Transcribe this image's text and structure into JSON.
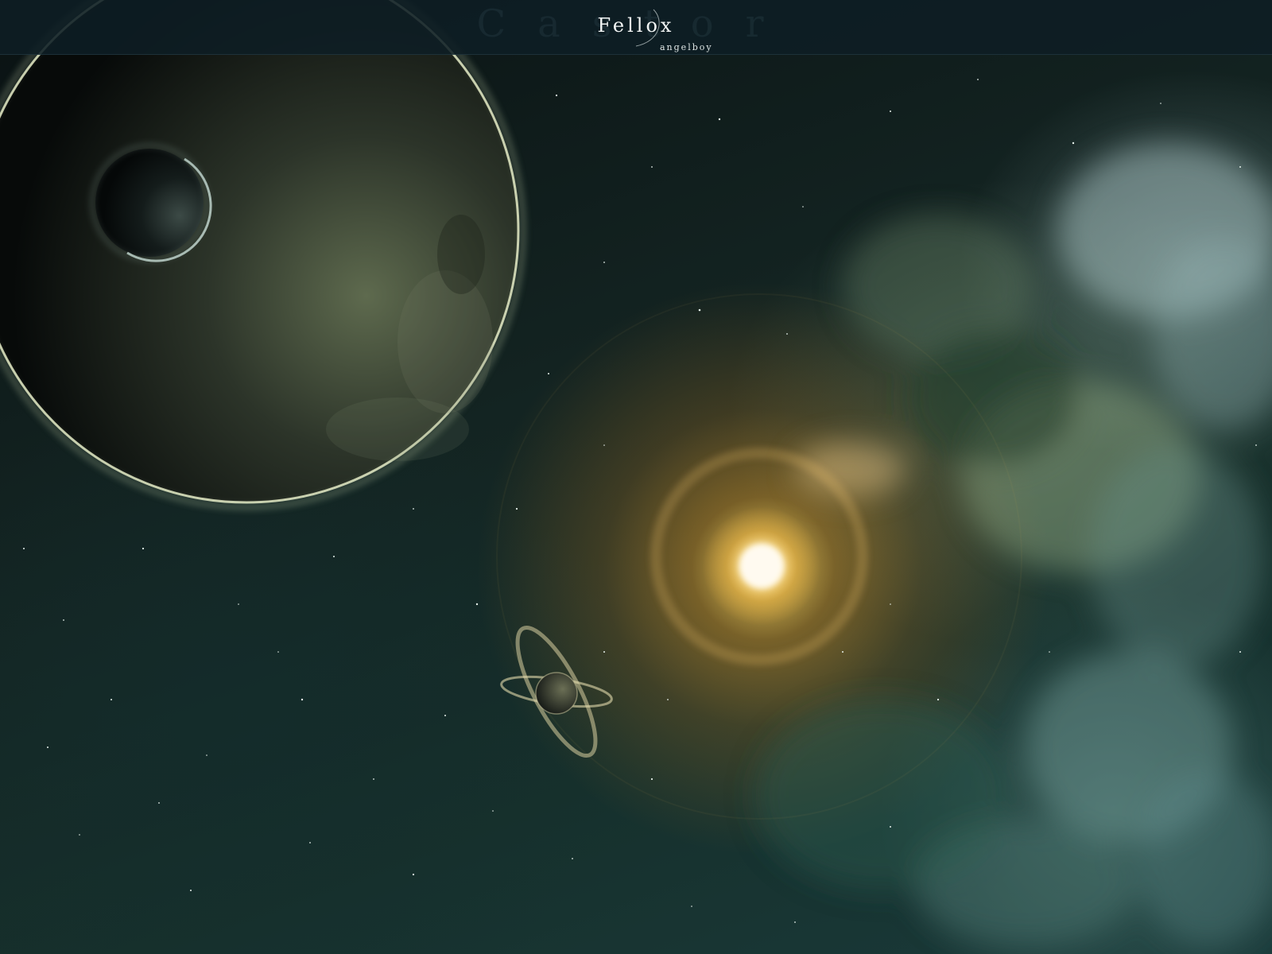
{
  "header": {
    "ghost_title": "Castor",
    "title": "Fellox",
    "subtitle": "angelboy"
  },
  "colors": {
    "space_dark": "#0b1517",
    "space_teal": "#1a3a3a",
    "sun_core": "#fff6d8",
    "sun_glow": "#f0a028",
    "planet_rim": "#e8ecc8",
    "nebula": "#a9c8c4"
  }
}
